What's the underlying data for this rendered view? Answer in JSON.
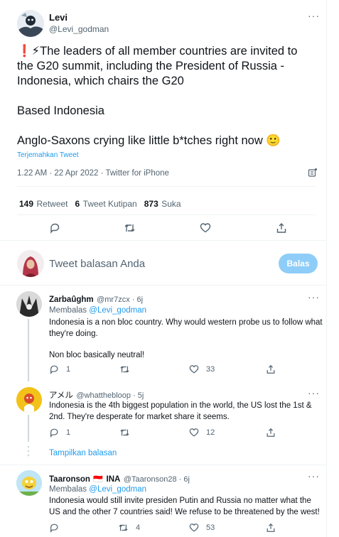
{
  "tweet": {
    "author_name": "Levi",
    "author_handle": "@Levi_godman",
    "more_label": "···",
    "text_line1": "❗⚡The leaders of all member countries are invited to the G20 summit, including the President of Russia - Indonesia, which chairs the G20",
    "text_line2": "Based Indonesia",
    "text_line3": "Anglo-Saxons crying like little b*tches right now 🙂",
    "translate_label": "Terjemahkan Tweet",
    "timestamp": "1.22 AM · 22 Apr 2022 · Twitter for iPhone"
  },
  "stats": {
    "retweets_count": "149",
    "retweets_label": "Retweet",
    "quotes_count": "6",
    "quotes_label": "Tweet Kutipan",
    "likes_count": "873",
    "likes_label": "Suka"
  },
  "compose": {
    "placeholder": "Tweet balasan Anda",
    "reply_button": "Balas"
  },
  "replies": [
    {
      "name": "Zarbaûghm",
      "handle": "@mr7zcx · 6j",
      "replying_prefix": "Membalas",
      "replying_to": "@Levi_godman",
      "text1": "Indonesia is a non bloc country. Why would western probe us to follow what they're doing.",
      "text2": "Non bloc basically neutral!",
      "replies": "1",
      "retweets": "",
      "likes": "33"
    },
    {
      "name": "アメル",
      "handle": "@whatthebloop · 5j",
      "text1": "Indonesia is the 4th biggest population in the world, the US lost the 1st & 2nd. They're desperate for market share it seems.",
      "replies": "1",
      "retweets": "",
      "likes": "12"
    },
    {
      "name": "Taaronson",
      "flag": "🇮🇩",
      "name_suffix": "INA",
      "handle": "@Taaronson28 · 6j",
      "replying_prefix": "Membalas",
      "replying_to": "@Levi_godman",
      "text1": "Indonesia would still invite presiden Putin and Russia no matter what the US and the other 7 countries said! We refuse to be threatened by the west!",
      "replies": "",
      "retweets": "4",
      "likes": "53"
    }
  ],
  "show_replies_label": "Tampilkan balasan",
  "colors": {
    "accent": "#1d9bf0",
    "muted": "#536471",
    "divider": "#eff3f4",
    "reply_button_bg": "#8ecdf8"
  }
}
